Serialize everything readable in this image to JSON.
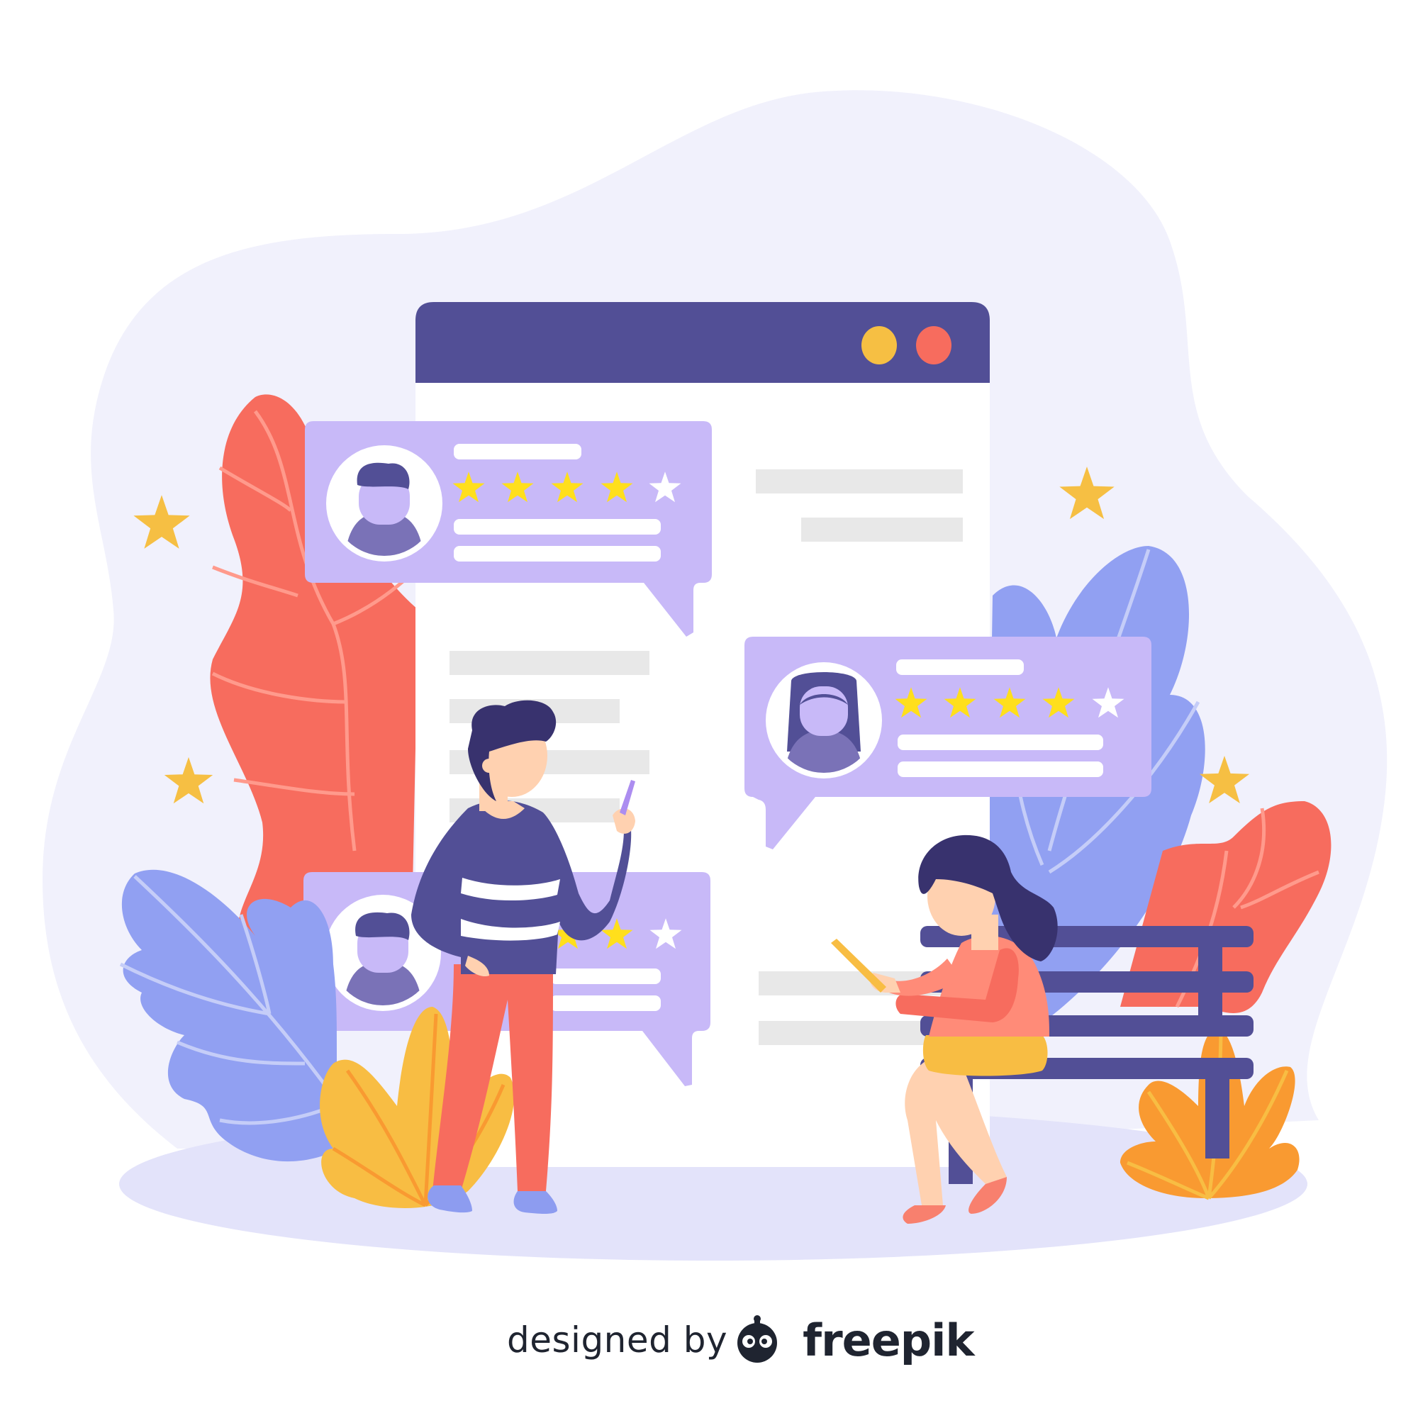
{
  "credit": {
    "designed_by": "designed by",
    "brand": "freepik",
    "logo_icon": "freepik-logo-icon"
  },
  "browser_window": {
    "controls": [
      {
        "name": "minimize-dot-icon",
        "color": "#f6bf43"
      },
      {
        "name": "close-dot-icon",
        "color": "#f76c5e"
      }
    ]
  },
  "reviews": [
    {
      "avatar": "male-avatar-icon",
      "rating": 4,
      "max_rating": 5
    },
    {
      "avatar": "female-avatar-icon",
      "rating": 4,
      "max_rating": 5
    },
    {
      "avatar": "male-avatar-icon",
      "rating": 4,
      "max_rating": 5
    }
  ],
  "colors": {
    "background_blob": "#f1f1fc",
    "ground": "#e3e3fa",
    "window_bar": "#524f96",
    "window_body": "#ffffff",
    "text_line": "#e8e8e8",
    "bubble": "#c8b9f8",
    "avatar_ring": "#ffffff",
    "avatar_body": "#7a72b7",
    "star_filled": "#ffdf1c",
    "star_empty": "#ffffff",
    "decor_star": "#f6bf43",
    "leaf_red": "#f76c5e",
    "leaf_blue": "#91a0f2",
    "leaf_yellow": "#f8bd43",
    "leaf_orange": "#f99a31",
    "bench": "#524f96"
  }
}
